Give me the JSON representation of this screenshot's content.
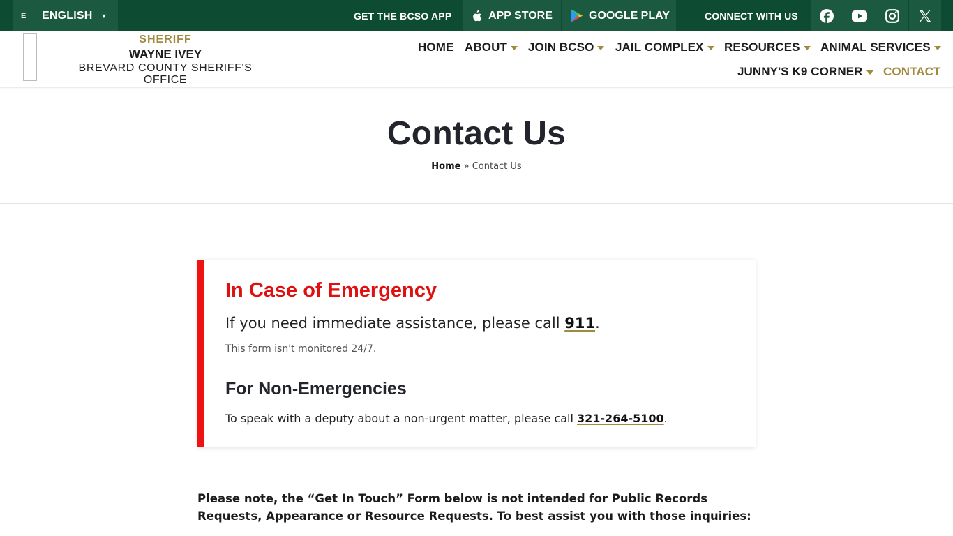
{
  "topbar": {
    "language": "ENGLISH",
    "flag_alt": "E",
    "get_app": "GET THE BCSO APP",
    "app_store": "APP STORE",
    "google_play": "GOOGLE PLAY",
    "connect": "CONNECT WITH US",
    "social_icons": [
      "facebook-icon",
      "youtube-icon",
      "instagram-icon",
      "x-icon"
    ]
  },
  "brand": {
    "line1": "SHERIFF",
    "line2": "WAYNE IVEY",
    "line3": "BREVARD COUNTY SHERIFF'S OFFICE"
  },
  "nav": {
    "home": "HOME",
    "about": "ABOUT",
    "join": "JOIN BCSO",
    "jail": "JAIL COMPLEX",
    "resources": "RESOURCES",
    "animal": "ANIMAL SERVICES",
    "k9": "JUNNY'S K9 CORNER",
    "contact": "CONTACT"
  },
  "page": {
    "title": "Contact Us",
    "breadcrumb_home": "Home",
    "breadcrumb_sep": " » ",
    "breadcrumb_current": "Contact Us"
  },
  "emergency": {
    "heading": "In Case of Emergency",
    "text_before": "If you need immediate assistance, please call ",
    "number": "911",
    "text_after": ".",
    "small": "This form isn't monitored 24/7."
  },
  "non_emergency": {
    "heading": "For Non-Emergencies",
    "text_before": "To speak with a deputy about a non-urgent matter, please call ",
    "number": "321-264-5100",
    "text_after": "."
  },
  "note": "Please note, the “Get In Touch” Form below is not intended for Public Records Requests, Appearance or Resource Requests. To best assist you with those inquiries:",
  "colors": {
    "topbar": "#0d4b33",
    "topbar_item": "#1b5a40",
    "gold": "#a08a3e",
    "emergency_red": "#ee1212"
  }
}
